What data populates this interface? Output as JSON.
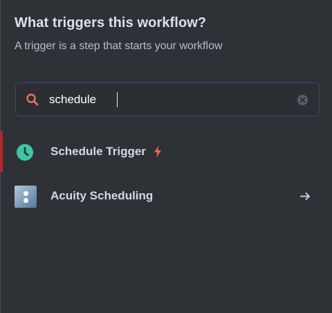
{
  "header": {
    "title": "What triggers this workflow?",
    "subtitle": "A trigger is a step that starts your workflow"
  },
  "search": {
    "value": "schedule",
    "icon": "search-icon",
    "clear_icon": "clear-icon",
    "accent_color": "#e8755a"
  },
  "results": [
    {
      "label": "Schedule Trigger",
      "icon": "clock-icon",
      "badge_icon": "lightning-bolt-icon",
      "active": true
    },
    {
      "label": "Acuity Scheduling",
      "icon": "acuity-scheduling-logo",
      "action_icon": "arrow-right-icon",
      "active": false
    }
  ],
  "colors": {
    "background": "#2e3136",
    "search_border": "#44427a",
    "active_indicator": "#b0282d",
    "clock": "#3fc7a1",
    "bolt": "#e8664f"
  }
}
